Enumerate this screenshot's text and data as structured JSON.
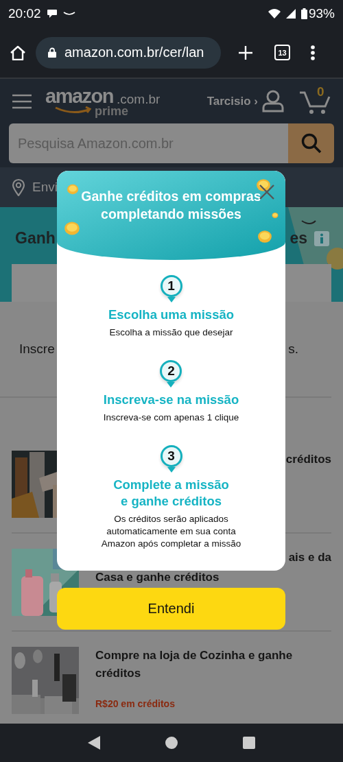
{
  "status_bar": {
    "time": "20:02",
    "battery": "93%"
  },
  "browser": {
    "url": "amazon.com.br/cer/lan",
    "tab_count": "13"
  },
  "header": {
    "logo": {
      "name": "amazon",
      "domain": ".com.br",
      "tier": "prime"
    },
    "account": "Tarcisio ›",
    "cart_count": "0",
    "search": {
      "placeholder": "Pesquisa Amazon.com.br"
    },
    "location": "Envi"
  },
  "banner": {
    "title_left": "Ganh",
    "title_right": "es"
  },
  "intro": {
    "left": "Inscre",
    "right": "s."
  },
  "missions": [
    {
      "title_right": "créditos"
    },
    {
      "title_right": "ais e da",
      "title": "Casa e ganhe créditos"
    },
    {
      "title": "Compre na loja de Cozinha e ganhe créditos",
      "reward": "R$20 em créditos"
    }
  ],
  "modal": {
    "title": "Ganhe créditos em compras completando missões",
    "steps": [
      {
        "number": "1",
        "title": "Escolha uma missão",
        "description": "Escolha a missão que desejar"
      },
      {
        "number": "2",
        "title": "Inscreva-se na missão",
        "description": "Inscreva-se com apenas 1 clique"
      },
      {
        "number": "3",
        "title": "Complete a missão e ganhe créditos",
        "description": "Os créditos serão aplicados automaticamente em sua conta Amazon após completar a missão"
      }
    ],
    "button": "Entendi"
  }
}
